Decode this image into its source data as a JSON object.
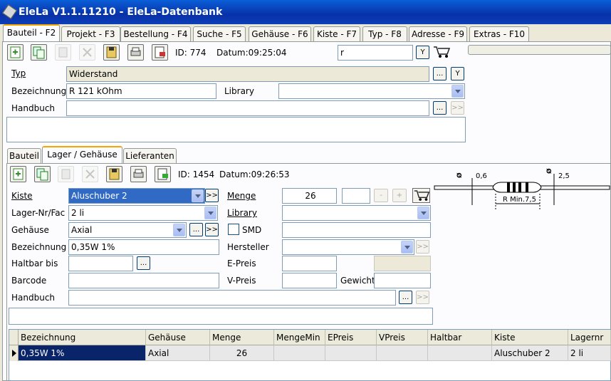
{
  "window": {
    "title": "EleLa V1.1.11210  - EleLa-Datenbank"
  },
  "main_tabs": [
    "Bauteil - F2",
    "Projekt - F3",
    "Bestellung - F4",
    "Suche - F5",
    "Gehäuse - F6",
    "Kiste - F7",
    "Typ - F8",
    "Adresse - F9",
    "Extras - F10"
  ],
  "top": {
    "id_label": "ID: 774",
    "datum_label": "Datum:09:25:04",
    "search_value": "r",
    "filter_btn": "Y",
    "typ_label": "Typ",
    "typ_value": "Widerstand",
    "ellipsis": "...",
    "typ_filter": "Y",
    "bezeichnung_label": "Bezeichnung",
    "bezeichnung_value": "R 121 kOhm",
    "library_label": "Library",
    "library_value": "",
    "handbuch_label": "Handbuch",
    "handbuch_value": "",
    "next": ">>"
  },
  "sub_tabs": [
    "Bauteil",
    "Lager / Gehäuse",
    "Lieferanten"
  ],
  "lager": {
    "id_label": "ID: 1454",
    "datum_label": "Datum:09:26:53",
    "kiste_label": "Kiste",
    "kiste_value": "Aluschuber 2",
    "menge_label": "Menge",
    "menge_value": "26",
    "stepper_value": "",
    "minus": "-",
    "plus": "+",
    "lagernr_label": "Lager-Nr/Fac",
    "lagernr_value": "2 li",
    "library_label": "Library",
    "library_value": "",
    "gehaeuse_label": "Gehäuse",
    "gehaeuse_value": "Axial",
    "smd_label": "SMD",
    "bezeichnung_label": "Bezeichnung",
    "bezeichnung_value": "0,35W 1%",
    "hersteller_label": "Hersteller",
    "hersteller_value": "",
    "haltbar_label": "Haltbar bis",
    "haltbar_value": "",
    "epreis_label": "E-Preis",
    "epreis_value": "",
    "barcode_label": "Barcode",
    "barcode_value": "",
    "vpreis_label": "V-Preis",
    "vpreis_value": "",
    "gewicht_label": "Gewicht",
    "gewicht_value": "",
    "handbuch_label": "Handbuch",
    "handbuch_value": "",
    "ellipsis": "...",
    "next": ">>"
  },
  "drawing": {
    "d1": "Ø0,6",
    "d2": "Ø2,5",
    "dim": "R Min.7,5",
    "values": [
      "0,6",
      "2,5",
      "R Min.7,5"
    ]
  },
  "grid": {
    "columns": [
      "Bezeichnung",
      "Gehäuse",
      "Menge",
      "MengeMin",
      "EPreis",
      "VPreis",
      "Haltbar",
      "Kiste",
      "Lagernr"
    ],
    "rows": [
      [
        "0,35W 1%",
        "Axial",
        "26",
        "",
        "",
        "",
        "",
        "Aluschuber 2",
        "2 li"
      ]
    ]
  }
}
